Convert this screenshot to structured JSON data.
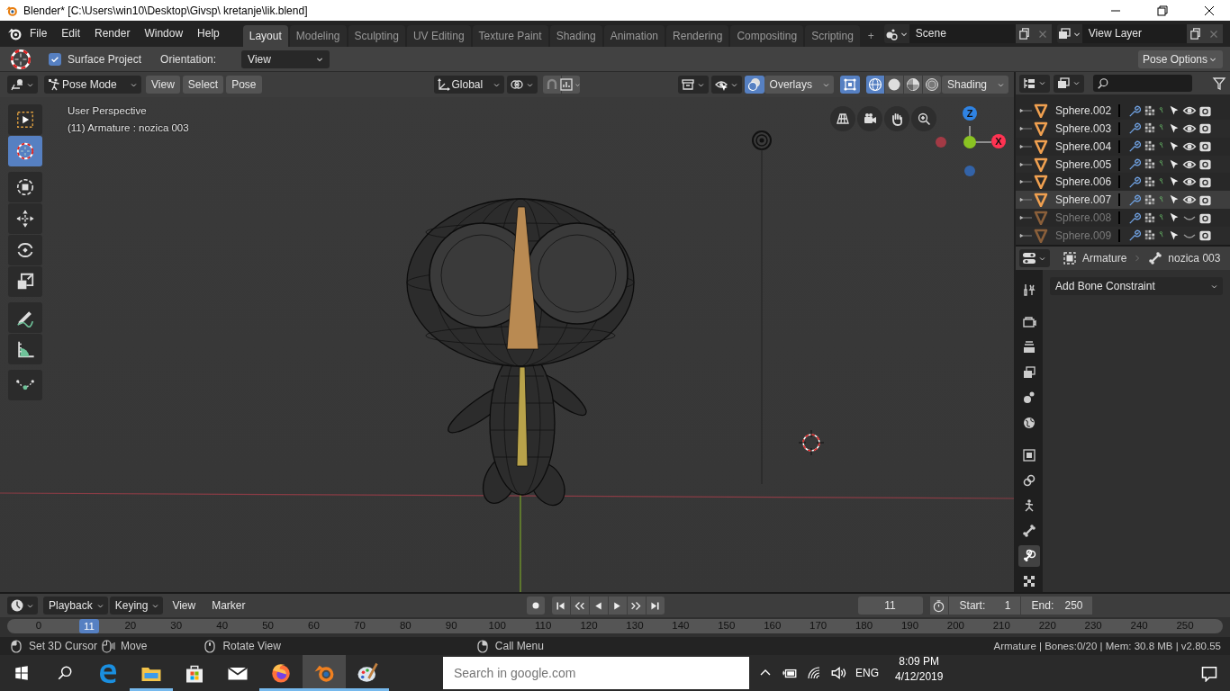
{
  "window": {
    "title": "Blender* [C:\\Users\\win10\\Desktop\\Givsp\\ kretanje\\lik.blend]"
  },
  "menu_bar": [
    "File",
    "Edit",
    "Render",
    "Window",
    "Help"
  ],
  "workspace_tabs": [
    {
      "label": "Layout",
      "selected": true
    },
    {
      "label": "Modeling",
      "selected": false
    },
    {
      "label": "Sculpting",
      "selected": false
    },
    {
      "label": "UV Editing",
      "selected": false
    },
    {
      "label": "Texture Paint",
      "selected": false
    },
    {
      "label": "Shading",
      "selected": false
    },
    {
      "label": "Animation",
      "selected": false
    },
    {
      "label": "Rendering",
      "selected": false
    },
    {
      "label": "Compositing",
      "selected": false
    },
    {
      "label": "Scripting",
      "selected": false
    },
    {
      "label": "+",
      "selected": false
    }
  ],
  "scene": {
    "value": "Scene"
  },
  "view_layer": {
    "value": "View Layer"
  },
  "tool_settings": {
    "surface_project": {
      "label": "Surface Project",
      "checked": true
    },
    "orientation_label": "Orientation:",
    "orientation": "View",
    "pose_options": "Pose Options"
  },
  "viewport_header": {
    "mode": "Pose Mode",
    "menus": [
      "View",
      "Select",
      "Pose"
    ],
    "transform_orientation": "Global",
    "overlays": {
      "label": "Overlays",
      "on": true
    },
    "xray": {
      "on": true
    },
    "shading_label": "Shading",
    "shading_modes": [
      {
        "kind": "wireframe",
        "selected": true
      },
      {
        "kind": "solid",
        "selected": false
      },
      {
        "kind": "material",
        "selected": false
      },
      {
        "kind": "rendered",
        "selected": false
      }
    ]
  },
  "tools": [
    {
      "kind": "select-box",
      "selected": false
    },
    {
      "kind": "cursor",
      "selected": true
    },
    {
      "kind": "transform",
      "selected": false
    },
    {
      "kind": "move",
      "selected": false
    },
    {
      "kind": "rotate",
      "selected": false
    },
    {
      "kind": "scale",
      "selected": false
    },
    {
      "kind": "annotate",
      "selected": false
    },
    {
      "kind": "measure",
      "selected": false
    },
    {
      "kind": "curve",
      "selected": false
    }
  ],
  "viewport_info": [
    "User Perspective",
    "(11) Armature : nozica 003"
  ],
  "gizmo": {
    "z": "Z",
    "x": "X"
  },
  "outliner": {
    "rows": [
      {
        "name": "Sphere.002",
        "visible": true,
        "selected": false
      },
      {
        "name": "Sphere.003",
        "visible": true,
        "selected": false
      },
      {
        "name": "Sphere.004",
        "visible": true,
        "selected": false
      },
      {
        "name": "Sphere.005",
        "visible": true,
        "selected": false
      },
      {
        "name": "Sphere.006",
        "visible": true,
        "selected": false
      },
      {
        "name": "Sphere.007",
        "visible": true,
        "selected": true
      },
      {
        "name": "Sphere.008",
        "visible": false,
        "selected": false
      },
      {
        "name": "Sphere.009",
        "visible": false,
        "selected": false
      }
    ]
  },
  "properties": {
    "breadcrumb": [
      "Armature",
      "nozica 003"
    ],
    "add_constraint": "Add Bone Constraint",
    "tabs": [
      {
        "kind": "tool",
        "selected": false
      },
      {
        "kind": "render",
        "selected": false
      },
      {
        "kind": "output",
        "selected": false
      },
      {
        "kind": "view-layer",
        "selected": false
      },
      {
        "kind": "scene",
        "selected": false
      },
      {
        "kind": "world",
        "selected": false
      },
      {
        "kind": "object",
        "selected": false
      },
      {
        "kind": "object-constraint",
        "selected": false
      },
      {
        "kind": "armature",
        "selected": false
      },
      {
        "kind": "bone",
        "selected": false
      },
      {
        "kind": "bone-constraint",
        "selected": true
      },
      {
        "kind": "texture",
        "selected": false
      }
    ]
  },
  "timeline": {
    "menus": [
      "Playback",
      "Keying",
      "View",
      "Marker"
    ],
    "current_frame": "11",
    "start_label": "Start:",
    "start": "1",
    "end_label": "End:",
    "end": "250",
    "playhead": "11",
    "ruler": [
      "0",
      "20",
      "30",
      "40",
      "50",
      "60",
      "70",
      "80",
      "90",
      "100",
      "110",
      "120",
      "130",
      "140",
      "150",
      "160",
      "170",
      "180",
      "190",
      "200",
      "210",
      "220",
      "230",
      "240",
      "250"
    ]
  },
  "status_bar": {
    "hints": [
      {
        "kind": "mouse-left",
        "label": "Set 3D Cursor"
      },
      {
        "kind": "mouse-drag",
        "label": "Move"
      },
      {
        "kind": "mouse-middle",
        "label": "Rotate View"
      },
      {
        "kind": "mouse-right",
        "label": "Call Menu"
      }
    ],
    "stats": "Armature | Bones:0/20  | Mem: 30.8 MB | v2.80.55"
  },
  "taskbar": {
    "apps": [
      {
        "kind": "edge",
        "running": false,
        "active": false
      },
      {
        "kind": "explorer",
        "running": true,
        "active": false
      },
      {
        "kind": "store",
        "running": false,
        "active": false
      },
      {
        "kind": "mail",
        "running": false,
        "active": false
      },
      {
        "kind": "firefox",
        "running": true,
        "active": false
      },
      {
        "kind": "blender",
        "running": true,
        "active": true
      },
      {
        "kind": "paint",
        "running": true,
        "active": false
      }
    ],
    "search_placeholder": "Search in google.com",
    "language": "ENG",
    "time": "8:09 PM",
    "date": "4/12/2019"
  }
}
